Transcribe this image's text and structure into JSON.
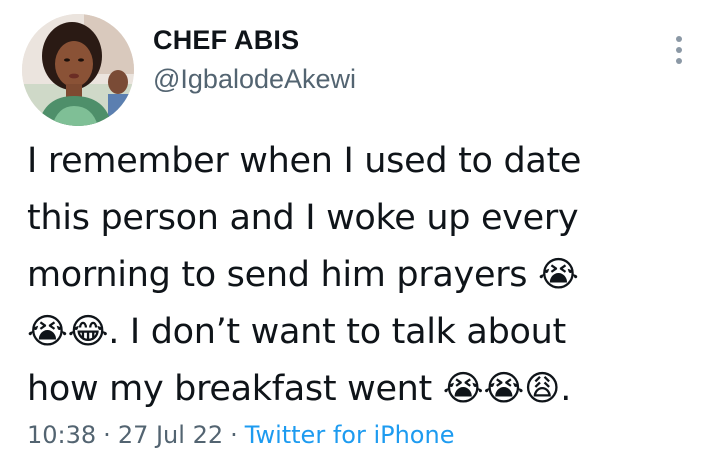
{
  "author": {
    "display_name": "CHEF ABIS",
    "handle": "@IgbalodeAkewi",
    "avatar_icon": "profile-photo"
  },
  "more_icon": "more-vertical-icon",
  "tweet": {
    "text": "I remember when I used to date\nthis person and I woke up every\nmorning to send him prayers 😭\n😭😂. I don’t want to talk about\nhow my breakfast went 😭😭😩."
  },
  "meta": {
    "time": "10:38",
    "separator": "·",
    "date": "27 Jul 22",
    "source": "Twitter for iPhone"
  },
  "colors": {
    "text_primary": "#0f1419",
    "text_secondary": "#536471",
    "link": "#1d9bf0",
    "background": "#ffffff"
  }
}
